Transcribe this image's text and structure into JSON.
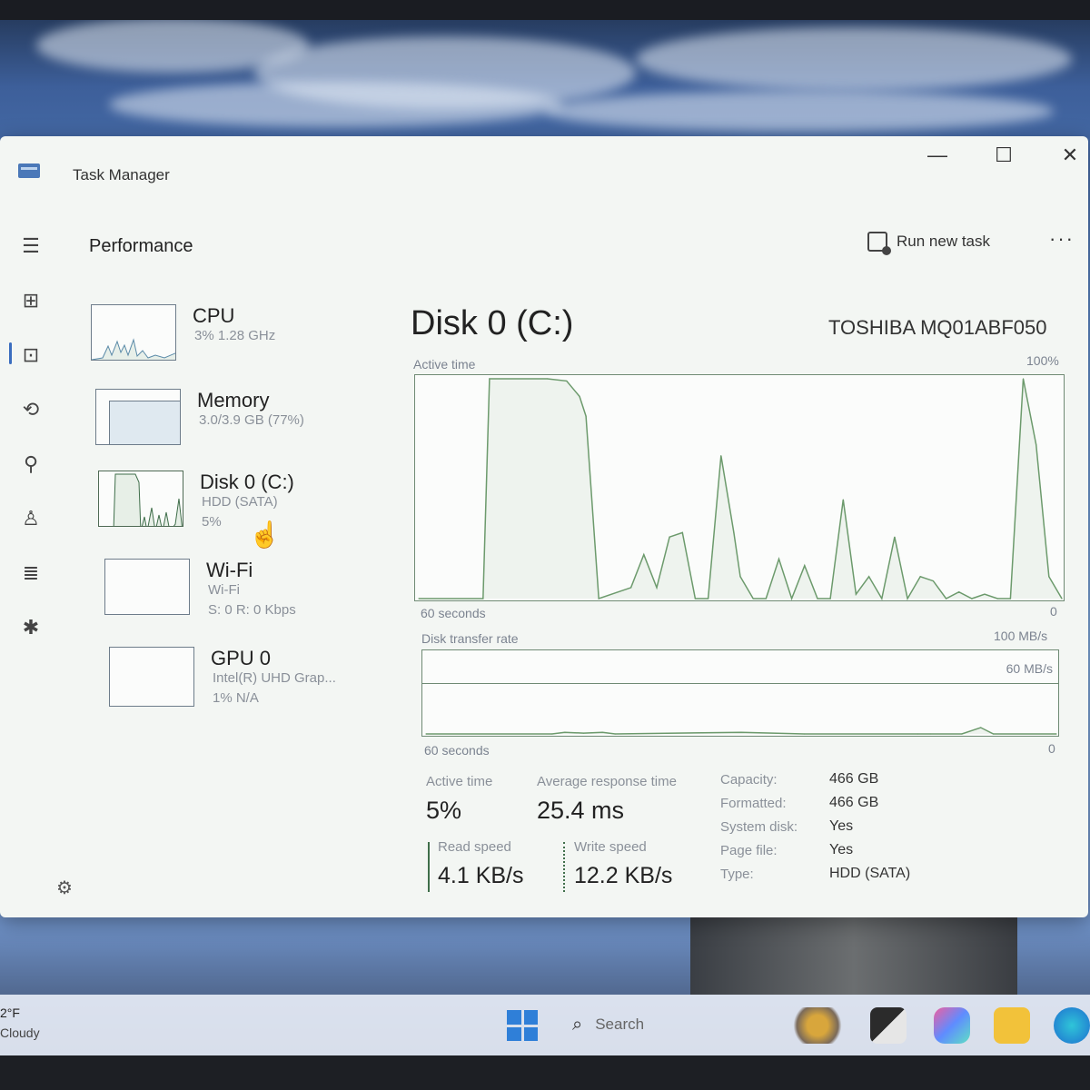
{
  "window": {
    "title": "Task Manager",
    "minimize_glyph": "—",
    "maximize_glyph": "☐",
    "close_glyph": "✕"
  },
  "nav": {
    "icons": [
      "hamburger-menu-icon",
      "processes-icon",
      "performance-icon",
      "app-history-icon",
      "startup-apps-icon",
      "users-icon",
      "details-icon",
      "services-icon",
      "settings-icon"
    ]
  },
  "page": {
    "title": "Performance",
    "run_new_task": "Run new task",
    "more": "···"
  },
  "resources": [
    {
      "name": "CPU",
      "sub1": "3% 1.28 GHz",
      "sub2": ""
    },
    {
      "name": "Memory",
      "sub1": "3.0/3.9 GB (77%)",
      "sub2": ""
    },
    {
      "name": "Disk 0 (C:)",
      "sub1": "HDD (SATA)",
      "sub2": "5%"
    },
    {
      "name": "Wi-Fi",
      "sub1": "Wi-Fi",
      "sub2": "S: 0 R: 0 Kbps"
    },
    {
      "name": "GPU 0",
      "sub1": "Intel(R) UHD Grap...",
      "sub2": "1% N/A"
    }
  ],
  "detail": {
    "title": "Disk 0 (C:)",
    "model": "TOSHIBA MQ01ABF050",
    "active_time_graph": {
      "label": "Active time",
      "max_label": "100%",
      "time_label": "60 seconds",
      "min_label": "0"
    },
    "transfer_graph": {
      "label": "Disk transfer rate",
      "max_label": "100 MB/s",
      "mid_label": "60 MB/s",
      "time_label": "60 seconds",
      "min_label": "0"
    },
    "stats": {
      "active_time_label": "Active time",
      "active_time_value": "5%",
      "avg_response_label": "Average response time",
      "avg_response_value": "25.4 ms",
      "read_speed_label": "Read speed",
      "read_speed_value": "4.1 KB/s",
      "write_speed_label": "Write speed",
      "write_speed_value": "12.2 KB/s"
    },
    "properties": [
      {
        "label": "Capacity:",
        "value": "466 GB"
      },
      {
        "label": "Formatted:",
        "value": "466 GB"
      },
      {
        "label": "System disk:",
        "value": "Yes"
      },
      {
        "label": "Page file:",
        "value": "Yes"
      },
      {
        "label": "Type:",
        "value": "HDD (SATA)"
      }
    ]
  },
  "chart_data": [
    {
      "type": "area",
      "title": "Active time",
      "ylim": [
        0,
        100
      ],
      "x": [
        0,
        10,
        11,
        20,
        23,
        25,
        26,
        28,
        33,
        35,
        37,
        39,
        41,
        43,
        45,
        47,
        49,
        50,
        52,
        54,
        56,
        58,
        60,
        62,
        64,
        66,
        68,
        70,
        72,
        74,
        76,
        78,
        80,
        82,
        84,
        86,
        88,
        90,
        92,
        94,
        96,
        98,
        100
      ],
      "y": [
        0,
        0,
        100,
        100,
        99,
        92,
        83,
        0,
        5,
        20,
        5,
        28,
        30,
        0,
        0,
        65,
        30,
        10,
        0,
        0,
        18,
        0,
        15,
        0,
        0,
        45,
        2,
        10,
        0,
        28,
        0,
        10,
        8,
        0,
        3,
        0,
        2,
        0,
        0,
        100,
        70,
        10,
        0
      ]
    },
    {
      "type": "area",
      "title": "Disk transfer rate",
      "ylim": [
        0,
        100
      ],
      "x": [
        0,
        20,
        22,
        25,
        28,
        30,
        50,
        60,
        78,
        80,
        85,
        88,
        90,
        100
      ],
      "y": [
        0,
        0,
        2,
        1,
        2,
        0,
        2,
        0,
        0,
        0,
        0,
        8,
        0,
        0
      ]
    }
  ],
  "taskbar": {
    "weather_temp": "2°F",
    "weather_desc": "Cloudy",
    "search_placeholder": "Search"
  },
  "colors": {
    "graph_line": "#6c9a6c",
    "graph_fill": "#eef3ee",
    "accent": "#3a6dbf"
  }
}
